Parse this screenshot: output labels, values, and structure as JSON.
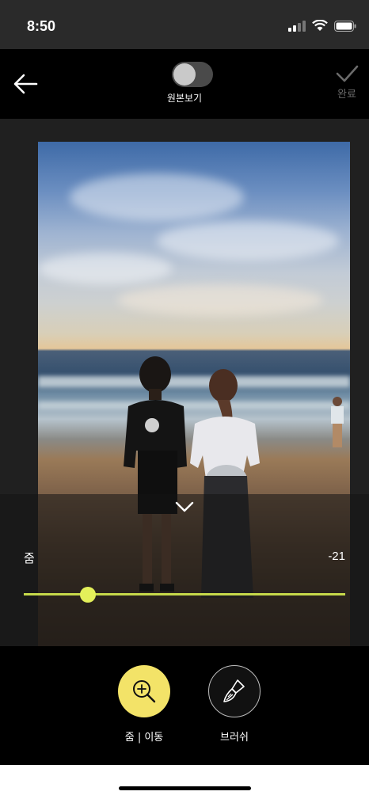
{
  "status_bar": {
    "time": "8:50"
  },
  "header": {
    "toggle_label": "원본보기",
    "toggle_on": false,
    "done_label": "완료"
  },
  "adjust": {
    "label": "줌",
    "value": "-21",
    "level_fraction": 0.2
  },
  "tools": [
    {
      "label": "줌 | 이동",
      "icon": "zoom-in-icon",
      "active": true
    },
    {
      "label": "브러쉬",
      "icon": "brush-icon",
      "active": false
    }
  ],
  "colors": {
    "accent": "#f3e368",
    "slider": "#c6d94a",
    "background": "#000000"
  }
}
